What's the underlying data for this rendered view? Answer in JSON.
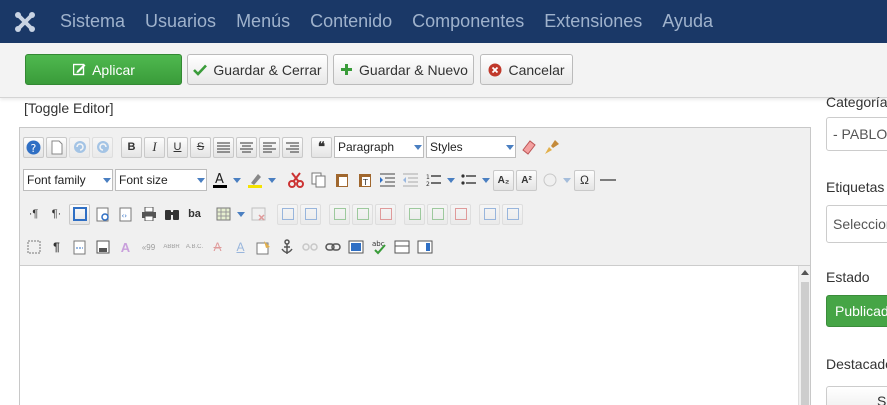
{
  "nav": {
    "items": [
      "Sistema",
      "Usuarios",
      "Menús",
      "Contenido",
      "Componentes",
      "Extensiones",
      "Ayuda"
    ]
  },
  "toolbar": {
    "apply": "Aplicar",
    "save_close": "Guardar & Cerrar",
    "save_new": "Guardar & Nuevo",
    "cancel": "Cancelar"
  },
  "editor": {
    "toggle": "[Toggle Editor]",
    "format_value": "Paragraph",
    "styles_value": "Styles",
    "font_family_value": "Font family",
    "font_size_value": "Font size",
    "btn_bold": "B",
    "btn_italic": "I",
    "btn_underline": "U",
    "btn_strike": "S",
    "btn_sub": "A₂",
    "btn_sup": "A²",
    "btn_omega": "Ω",
    "btn_ba": "ba",
    "btn_quote": "❝",
    "btn_cite": "‹›"
  },
  "sidebar": {
    "category_label": "Categoría",
    "category_value": "- PABLO",
    "tags_label": "Etiquetas",
    "tags_placeholder": "Seleccione",
    "status_label": "Estado",
    "status_value": "Publicado",
    "featured_label": "Destacado",
    "featured_value": "Sí"
  },
  "colors": {
    "nav_bg": "#1a3867",
    "apply_green": "#46a546",
    "status_green": "#46a546"
  }
}
